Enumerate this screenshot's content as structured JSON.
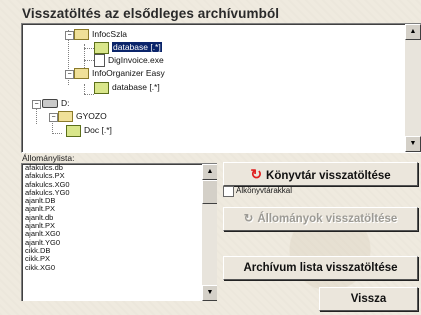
{
  "window": {
    "title": "Visszatöltés az elsődleges archívumból"
  },
  "tree": {
    "nodes": [
      {
        "label": "InfocSzla"
      },
      {
        "label": "database [.*]"
      },
      {
        "label": "DigInvoice.exe"
      },
      {
        "label": "InfoOrganizer Easy"
      },
      {
        "label": "database [.*]"
      },
      {
        "label": "D:"
      },
      {
        "label": "GYOZO"
      },
      {
        "label": "Doc [.*]"
      }
    ]
  },
  "filelist": {
    "label": "Állománylista:",
    "items": [
      "afakulcs.db",
      "afakulcs.PX",
      "afakulcs.XG0",
      "afakulcs.YG0",
      "ajanlt.DB",
      "ajanlt.PX",
      "ajanlt.db",
      "ajanlt.PX",
      "ajanlt.XG0",
      "ajanlt.YG0",
      "cikk.DB",
      "cikk.PX",
      "cikk.XG0"
    ]
  },
  "buttons": {
    "restore_dir": "Könyvtár visszatöltése",
    "with_subdirs": "Alkönyvtárakkal",
    "restore_files": "Állományok visszatöltése",
    "restore_archive_list": "Archívum lista visszatöltése",
    "back": "Vissza"
  },
  "colors": {
    "accent_icon": "#e02020",
    "selection": "#0a246a"
  }
}
